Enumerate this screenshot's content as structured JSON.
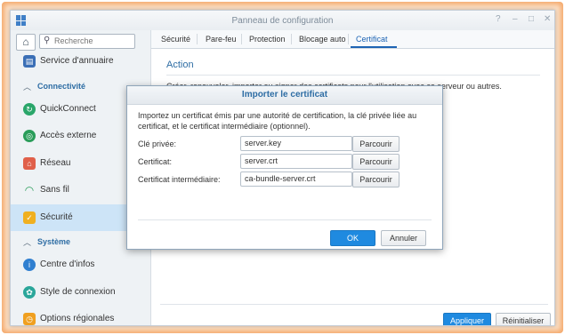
{
  "window": {
    "title": "Panneau de configuration",
    "controls": [
      "?",
      "–",
      "□",
      "✕"
    ]
  },
  "sidebar": {
    "search_placeholder": "Recherche",
    "items": [
      {
        "label": "Service d'annuaire",
        "icon": "directory-service-icon"
      },
      {
        "section": "Connectivité"
      },
      {
        "label": "QuickConnect",
        "icon": "quickconnect-icon"
      },
      {
        "label": "Accès externe",
        "icon": "external-access-icon"
      },
      {
        "label": "Réseau",
        "icon": "network-icon"
      },
      {
        "label": "Sans fil",
        "icon": "wireless-icon"
      },
      {
        "label": "Sécurité",
        "icon": "security-shield-icon",
        "active": true
      },
      {
        "section": "Système"
      },
      {
        "label": "Centre d'infos",
        "icon": "info-center-icon"
      },
      {
        "label": "Style de connexion",
        "icon": "login-style-icon"
      },
      {
        "label": "Options régionales",
        "icon": "regional-options-icon"
      }
    ]
  },
  "tabs": [
    "Sécurité",
    "Pare-feu",
    "Protection",
    "Blocage auto",
    "Certificat"
  ],
  "active_tab": "Certificat",
  "main": {
    "action_title": "Action",
    "action_desc": "Créer, renouveler, importer ou signer des certificats pour l'utilisation avec ce serveur ou autres.",
    "apply_label": "Appliquer",
    "reset_label": "Réinitialiser"
  },
  "dialog": {
    "title": "Importer le certificat",
    "description": "Importez un certificat émis par une autorité de certification, la clé privée liée au certificat, et le certificat intermédiaire (optionnel).",
    "rows": [
      {
        "label": "Clé privée:",
        "value": "server.key",
        "button": "Parcourir"
      },
      {
        "label": "Certificat:",
        "value": "server.crt",
        "button": "Parcourir"
      },
      {
        "label": "Certificat intermédiaire:",
        "value": "ca-bundle-server.crt",
        "button": "Parcourir"
      }
    ],
    "ok_label": "OK",
    "cancel_label": "Annuler"
  },
  "colors": {
    "accent": "#1f8ae0",
    "frame_glow": "#f4a86a",
    "active_item": "#cde4f7"
  }
}
